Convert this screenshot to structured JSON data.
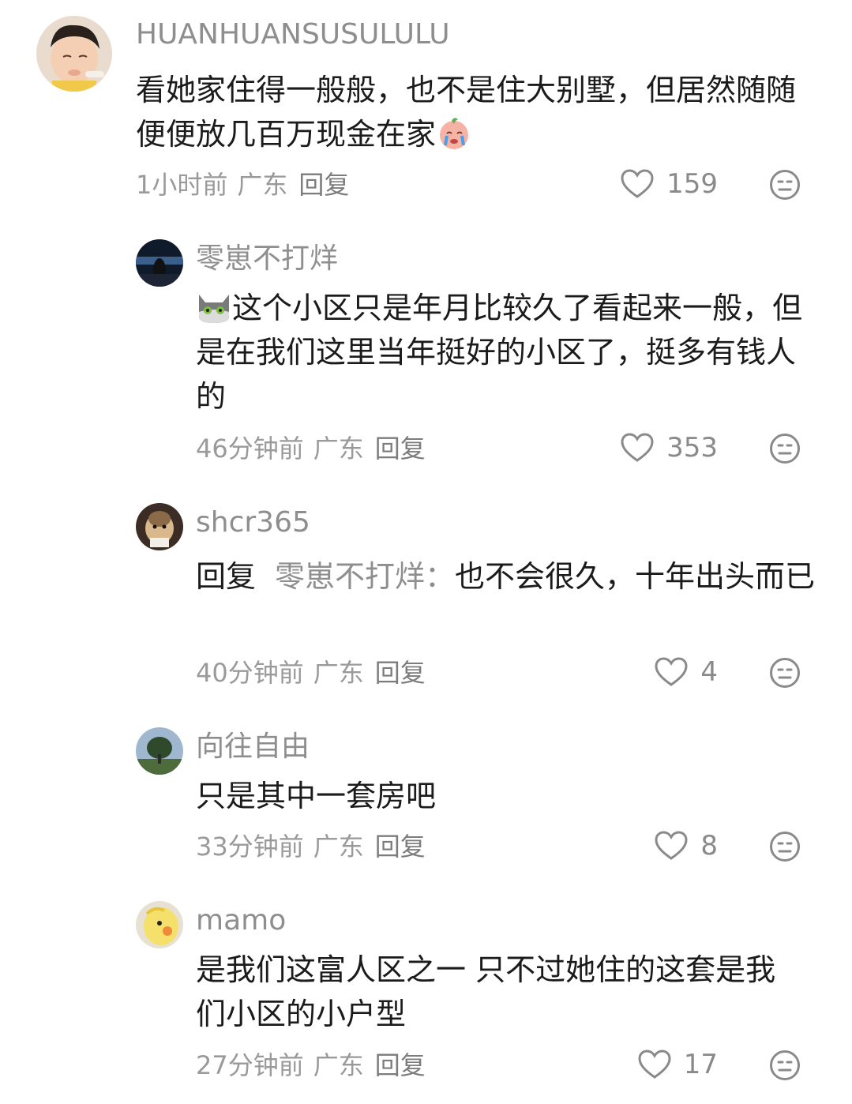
{
  "comments": [
    {
      "username": "HUANHUANSUSULULU",
      "text": "看她家住得一般般，也不是住大别墅，但居然随随便便放几百万现金在家",
      "emoji": "crying-peach-emoji",
      "time": "1小时前",
      "location": "广东",
      "reply_label": "回复",
      "likes": "159"
    },
    {
      "username": "零崽不打烊",
      "emoji": "cat-emoji",
      "text": "这个小区只是年月比较久了看起来一般，但是在我们这里当年挺好的小区了，挺多有钱人的",
      "time": "46分钟前",
      "location": "广东",
      "reply_label": "回复",
      "likes": "353"
    },
    {
      "username": "shcr365",
      "reply_word": "回复",
      "reply_to": "零崽不打烊：",
      "text": "也不会很久，十年出头而已",
      "time": "40分钟前",
      "location": "广东",
      "reply_label": "回复",
      "likes": "4"
    },
    {
      "username": "向往自由",
      "text": "只是其中一套房吧",
      "time": "33分钟前",
      "location": "广东",
      "reply_label": "回复",
      "likes": "8"
    },
    {
      "username": "mamo",
      "text": "是我们这富人区之一 只不过她住的这套是我们小区的小户型",
      "time": "27分钟前",
      "location": "广东",
      "reply_label": "回复",
      "likes": "17"
    }
  ],
  "colors": {
    "username": "#8e8e8e",
    "text": "#1b1b1b",
    "meta": "#9a9a9a",
    "icon": "#8a8a8a"
  }
}
